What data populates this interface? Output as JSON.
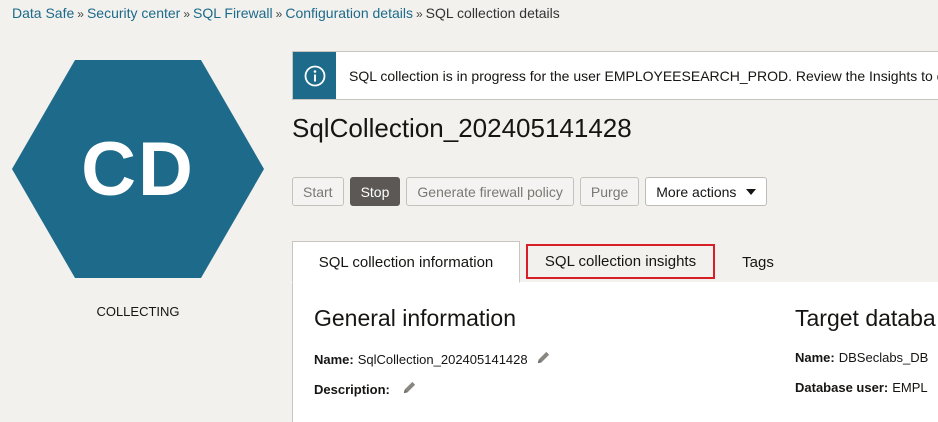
{
  "breadcrumb": {
    "items": [
      "Data Safe",
      "Security center",
      "SQL Firewall",
      "Configuration details"
    ],
    "separator": "»",
    "current": "SQL collection details"
  },
  "badge": {
    "initials": "CD",
    "status": "COLLECTING",
    "color": "#1d6a8a"
  },
  "banner": {
    "icon": "info-icon",
    "message": "SQL collection is in progress for the user EMPLOYEESEARCH_PROD. Review the Insights to d"
  },
  "title": "SqlCollection_202405141428",
  "toolbar": {
    "start": "Start",
    "stop": "Stop",
    "generate": "Generate firewall policy",
    "purge": "Purge",
    "more": "More actions"
  },
  "tabs": {
    "info": "SQL collection information",
    "insights": "SQL collection insights",
    "tags": "Tags"
  },
  "general": {
    "title": "General information",
    "name_label": "Name:",
    "name_value": "SqlCollection_202405141428",
    "desc_label": "Description:"
  },
  "target": {
    "title": "Target databa",
    "name_label": "Name:",
    "name_value": "DBSeclabs_DB",
    "user_label": "Database user:",
    "user_value": "EMPL"
  },
  "colors": {
    "accent": "#1d6a8a",
    "highlight": "#d61f26",
    "primary_button": "#5b5855"
  }
}
